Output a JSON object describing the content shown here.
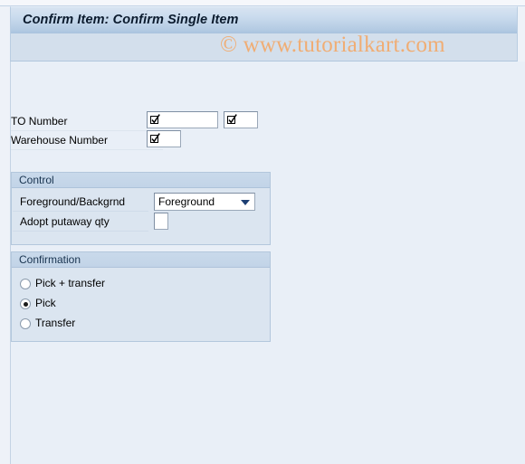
{
  "window": {
    "title": "Confirm Item: Confirm Single Item",
    "watermark": "© www.tutorialkart.com"
  },
  "form": {
    "fields": [
      {
        "label": "TO Number",
        "value": "",
        "helper_icon": "value-help-icon",
        "second_value": "",
        "second_helper_icon": "value-help-icon"
      },
      {
        "label": "Warehouse Number",
        "value": "",
        "helper_icon": "value-help-icon"
      }
    ]
  },
  "control_group": {
    "title": "Control",
    "processing_label": "Foreground/Backgrnd",
    "processing_value": "Foreground",
    "processing_options": [
      "Foreground"
    ],
    "adopt_label": "Adopt putaway qty",
    "adopt_value": ""
  },
  "confirmation_group": {
    "title": "Confirmation",
    "options": [
      {
        "label": "Pick + transfer",
        "selected": false
      },
      {
        "label": "Pick",
        "selected": true
      },
      {
        "label": "Transfer",
        "selected": false
      }
    ]
  },
  "colors": {
    "title_bar_top": "#d7e3f1",
    "title_bar_bottom": "#a9c3de",
    "canvas_bg": "#e9eff7",
    "group_bg": "#dbe5f0",
    "group_header": "#c5d6e9",
    "watermark": "#f0ad74",
    "dropdown_arrow": "#1d3f73"
  }
}
